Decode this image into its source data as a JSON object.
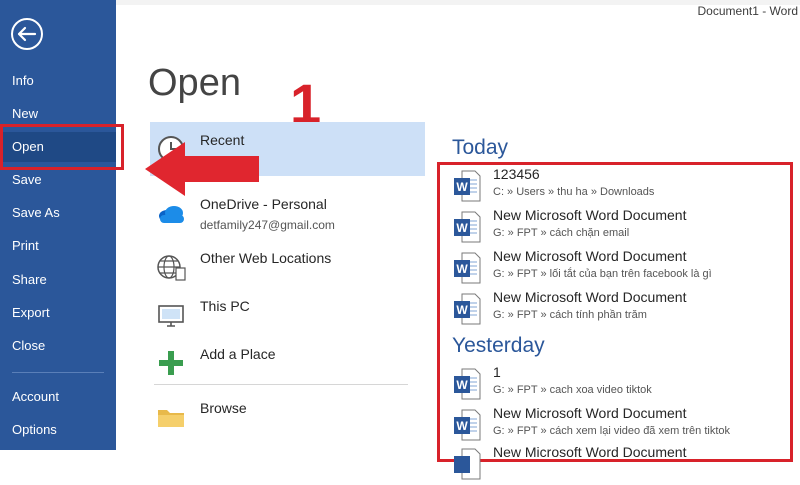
{
  "window_title": "Document1 - Word",
  "sidebar": {
    "items": [
      {
        "label": "Info"
      },
      {
        "label": "New"
      },
      {
        "label": "Open"
      },
      {
        "label": "Save"
      },
      {
        "label": "Save As"
      },
      {
        "label": "Print"
      },
      {
        "label": "Share"
      },
      {
        "label": "Export"
      },
      {
        "label": "Close"
      },
      {
        "label": "Account"
      },
      {
        "label": "Options"
      }
    ],
    "active": "Open"
  },
  "page_title": "Open",
  "annotation_number": "1",
  "locations": [
    {
      "label": "Recent",
      "icon": "clock-icon"
    },
    {
      "label": "OneDrive - Personal",
      "sub": "detfamily247@gmail.com",
      "icon": "onedrive-cloud-icon"
    },
    {
      "label": "Other Web Locations",
      "icon": "globe-icon"
    },
    {
      "label": "This PC",
      "icon": "computer-icon"
    },
    {
      "label": "Add a Place",
      "icon": "plus-icon"
    },
    {
      "label": "Browse",
      "icon": "folder-icon"
    }
  ],
  "recent": {
    "today_label": "Today",
    "yesterday_label": "Yesterday",
    "today": [
      {
        "name": "123456",
        "path": "C: » Users » thu ha » Downloads"
      },
      {
        "name": "New Microsoft Word Document",
        "path": "G: » FPT » cách chặn email"
      },
      {
        "name": "New Microsoft Word Document",
        "path": "G: » FPT » lối tắt của bạn trên facebook là gì"
      },
      {
        "name": "New Microsoft Word Document",
        "path": "G: » FPT » cách tính phần trăm"
      }
    ],
    "yesterday": [
      {
        "name": "1",
        "path": "G: » FPT » cach xoa video tiktok"
      },
      {
        "name": "New Microsoft Word Document",
        "path": "G: » FPT » cách xem lại video đã xem trên tiktok"
      },
      {
        "name": "New Microsoft Word Document",
        "path": ""
      }
    ]
  },
  "colors": {
    "sidebar": "#2b579a",
    "accent": "#2b579a",
    "annotation_red": "#d8222a",
    "selected": "#cde0f7"
  }
}
